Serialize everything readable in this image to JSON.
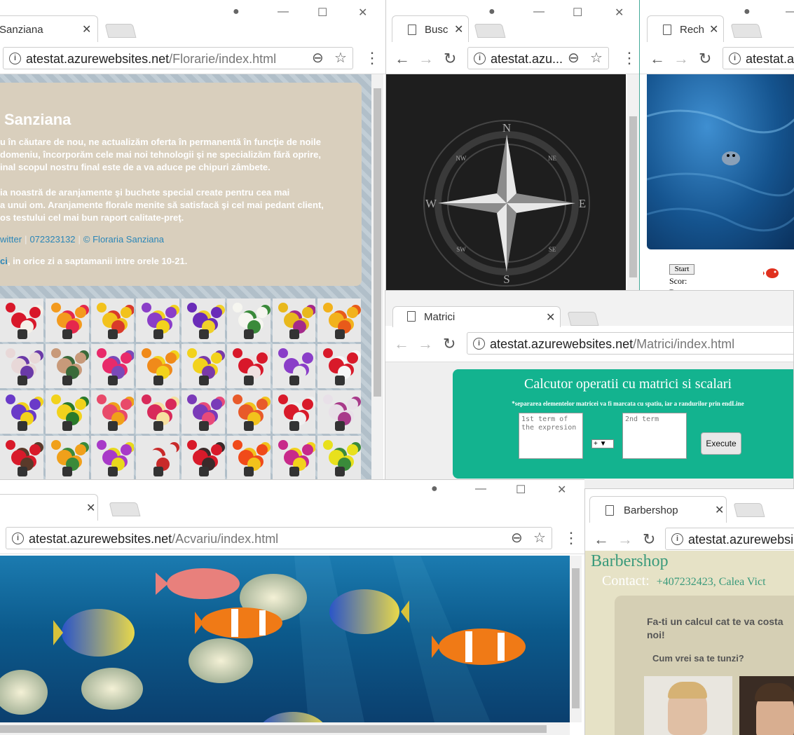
{
  "floraria": {
    "tab_title": "Sanziana",
    "url_host": "atestat.azurewebsites.net",
    "url_path": "/Florarie/index.html",
    "heading": "Sanziana",
    "lines": [
      "u în căutare de nou, ne actualizăm oferta în permanentă în funcţie de noile",
      "domeniu, încorporăm cele mai noi tehnologii şi ne specializăm fără oprire,",
      "inal scopul nostru final este de a va aduce pe chipuri zâmbete.",
      "ia noastră de aranjamente şi buchete special create pentru cea mai",
      " a unui om. Aranjamente florale menite să satisfacă şi cel mai pedant client,",
      "os testului cel mai bun raport calitate-preţ."
    ],
    "link_twitter": "witter",
    "phone": "072323132",
    "copyright": "© Floraria Sanziana",
    "hours_link": "ci",
    "hours_text": ", in orice zi a saptamanii intre orele 10-21."
  },
  "compass_window": {
    "tab_title": "Busc",
    "url_host": "atestat.azu...",
    "directions": [
      "N",
      "E",
      "S",
      "W"
    ],
    "minor": [
      "NE",
      "SE",
      "SW",
      "NW"
    ]
  },
  "fish_game": {
    "tab_title": "Rech",
    "url_host": "atestat.az",
    "start_label": "Start",
    "score_label": "Scor:",
    "best_label": "Best:"
  },
  "matrici": {
    "tab_title": "Matrici",
    "url_host": "atestat.azurewebsites.net",
    "url_path": "/Matrici/index.html",
    "title": "Calcutor operatii cu matrici si scalari",
    "note": "*separarea elementelor matricei va fi marcata cu spatiu, iar a randurilor prin endLine",
    "placeholder1": "1st term of the expresion",
    "placeholder2": "2nd term",
    "operator": "+",
    "execute_label": "Execute"
  },
  "acvariu": {
    "url_host": "atestat.azurewebsites.net",
    "url_path": "/Acvariu/index.html"
  },
  "barbershop": {
    "tab_title": "Barbershop",
    "url_host": "atestat.azurewebsi...",
    "title": "Barbershop",
    "contact_label": "Contact:",
    "contact_value": "+407232423,  Calea Vict",
    "card_heading": "Fa-ti un calcul cat te va costa noi!",
    "card_question": "Cum vrei sa te tunzi?"
  },
  "colors": {
    "matrici_accent": "#13b38f",
    "barber_accent": "#3a9a7b",
    "flor_link": "#2b86b7"
  }
}
